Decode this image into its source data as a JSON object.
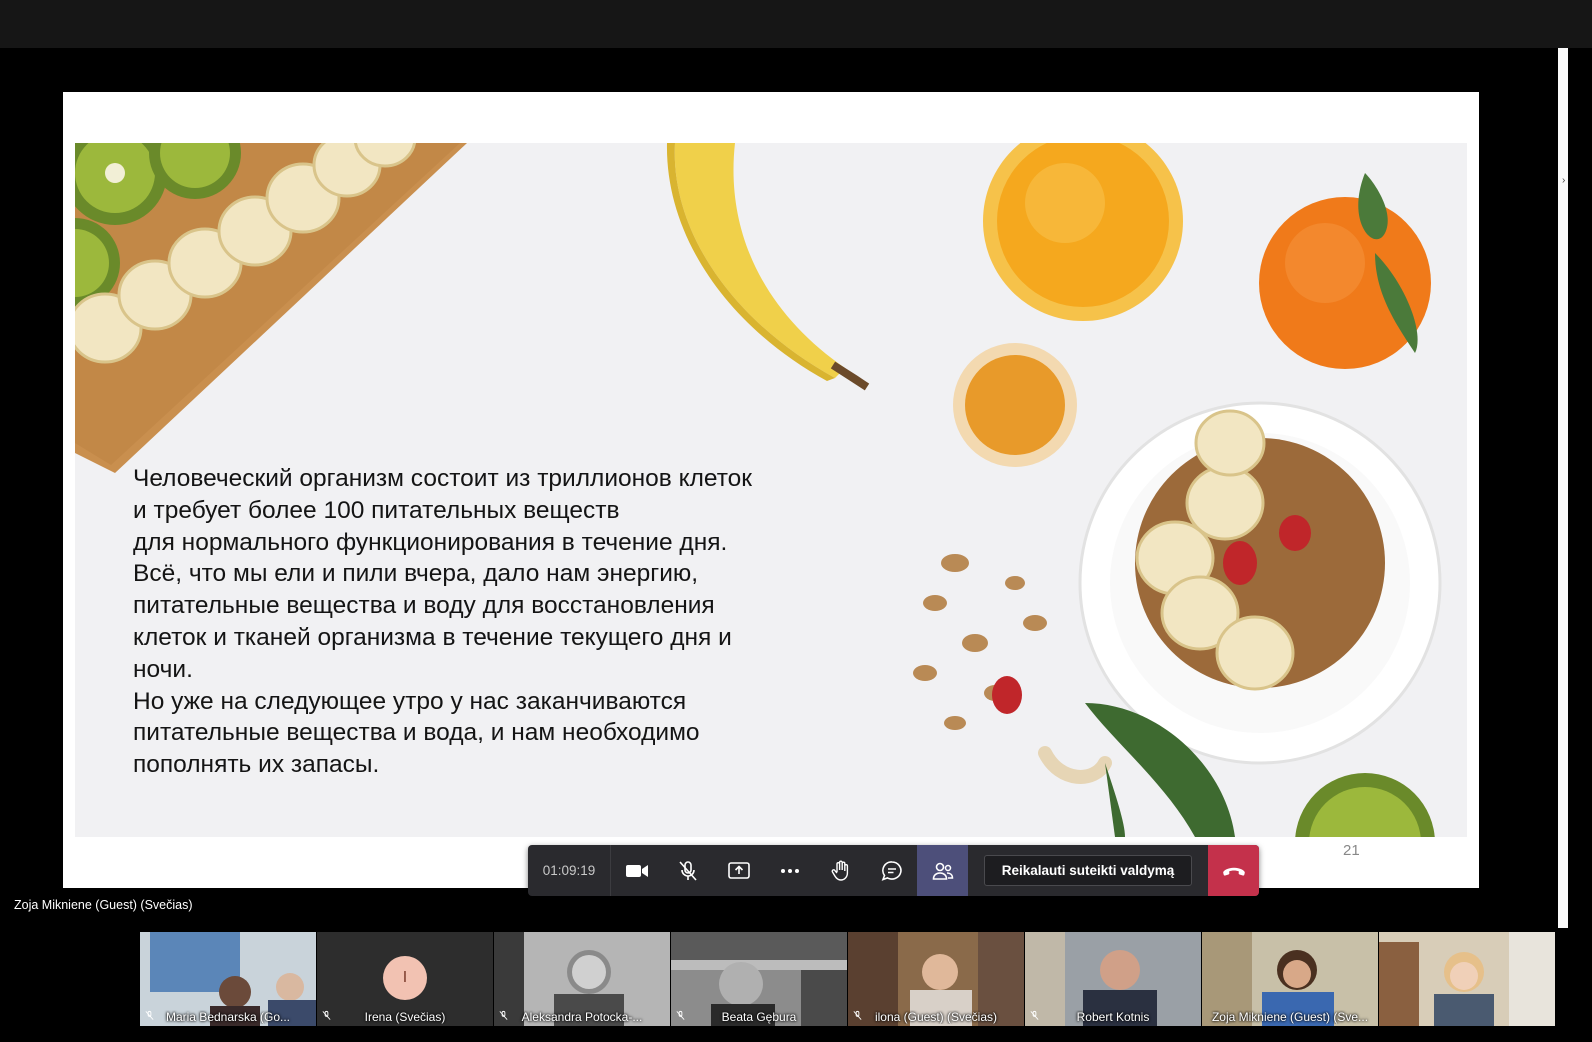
{
  "slide": {
    "text_lines": [
      "Человеческий организм состоит из триллионов клеток",
      "и требует более 100 питательных веществ",
      "для нормального функционирования в течение дня.",
      "Всё, что мы ели и пили вчера, дало нам энергию,",
      "питательные вещества и воду для восстановления",
      "клеток и тканей организма в течение текущего дня и",
      "ночи.",
      "Но уже на следующее утро у нас заканчиваются",
      "питательные вещества и вода, и нам необходимо",
      "пополнять их запасы."
    ],
    "page_number": "21"
  },
  "presenter_label": "Zoja Mikniene (Guest) (Svečias)",
  "controls": {
    "timer": "01:09:19",
    "request_control_label": "Reikalauti suteikti valdymą",
    "icons": [
      "camera-icon",
      "mic-off-icon",
      "share-tray-icon",
      "more-icon",
      "raise-hand-icon",
      "chat-icon",
      "participants-icon",
      "hang-up-icon"
    ]
  },
  "participants": [
    {
      "name": "Maria Bednarska (Go...",
      "muted": true,
      "video": true
    },
    {
      "name": "Irena (Svečias)",
      "muted": true,
      "video": false,
      "initial": "I"
    },
    {
      "name": "Aleksandra Potocka-...",
      "muted": true,
      "video": true
    },
    {
      "name": "Beata Gębura",
      "muted": true,
      "video": true
    },
    {
      "name": "ilona (Guest) (Svečias)",
      "muted": true,
      "video": true
    },
    {
      "name": "Robert Kotnis",
      "muted": true,
      "video": true
    },
    {
      "name": "Zoja Mikniene (Guest) (Sve...",
      "muted": false,
      "video": true
    },
    {
      "name": "",
      "muted": false,
      "video": true
    }
  ],
  "colors": {
    "hangup": "#c4314b",
    "active_toggle": "#4d4f7a",
    "toolbar": "#2a2a2e"
  }
}
